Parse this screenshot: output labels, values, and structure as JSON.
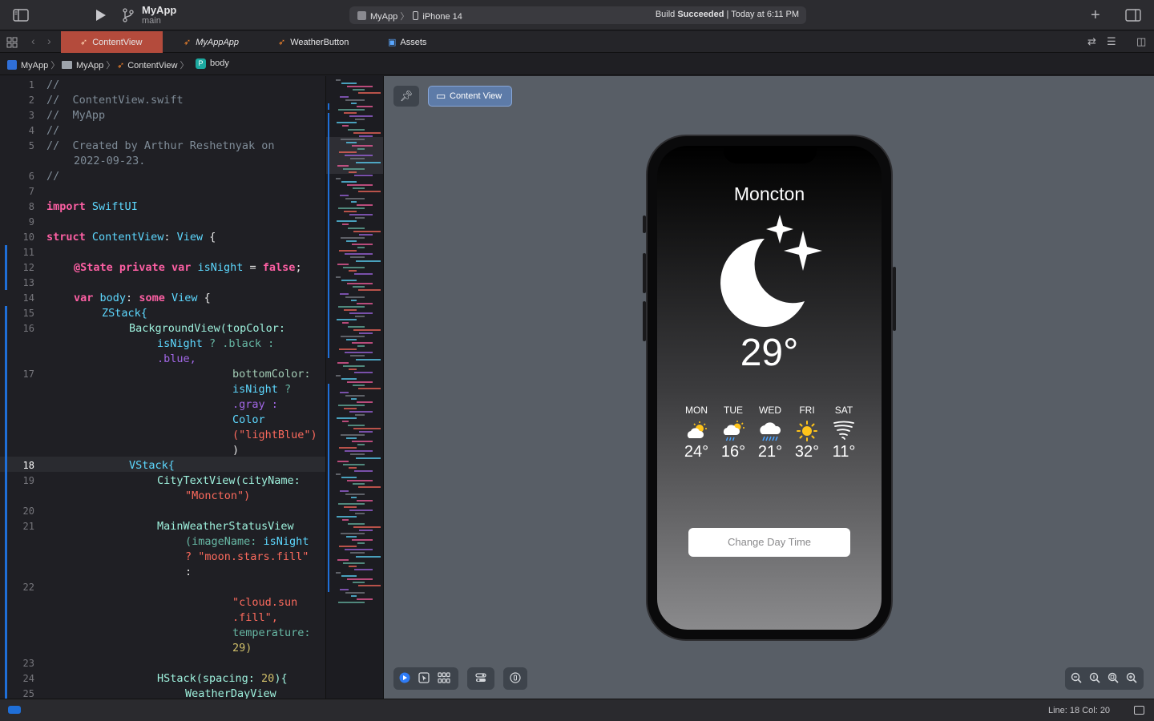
{
  "toolbar": {
    "project_name": "MyApp",
    "branch": "main",
    "scheme": "MyApp",
    "scheme_sep": "〉",
    "device": "iPhone 14",
    "build_label": "Build ",
    "build_status": "Succeeded",
    "build_time": " | Today at 6:11 PM"
  },
  "tabs": [
    {
      "label": "ContentView",
      "active": true
    },
    {
      "label": "MyAppApp",
      "active": false
    },
    {
      "label": "WeatherButton",
      "active": false
    },
    {
      "label": "Assets",
      "active": false
    }
  ],
  "jumpbar": {
    "items": [
      "MyApp",
      "MyApp",
      "ContentView",
      "body"
    ],
    "sep": "〉",
    "body_badge": "P"
  },
  "editor": {
    "current_line": "18",
    "lines": [
      {
        "num": "1",
        "text": "//"
      },
      {
        "num": "2",
        "text": "//  ContentView.swift"
      },
      {
        "num": "3",
        "text": "//  MyApp"
      },
      {
        "num": "4",
        "text": "//"
      },
      {
        "num": "5",
        "text": "//  Created by Arthur Reshetnyak on"
      },
      {
        "num": "",
        "text": "2022-09-23."
      },
      {
        "num": "6",
        "text": "//"
      },
      {
        "num": "7",
        "text": ""
      },
      {
        "num": "8",
        "text": "import SwiftUI"
      },
      {
        "num": "9",
        "text": ""
      },
      {
        "num": "10",
        "text": "struct ContentView: View {"
      },
      {
        "num": "11",
        "text": ""
      },
      {
        "num": "12",
        "text": "@State private var isNight = false;"
      },
      {
        "num": "13",
        "text": ""
      },
      {
        "num": "14",
        "text": "var body: some View {"
      },
      {
        "num": "15",
        "text": "ZStack{"
      },
      {
        "num": "16",
        "text": "BackgroundView(topColor:"
      },
      {
        "num": "",
        "text": "isNight ? .black :"
      },
      {
        "num": "",
        "text": ".blue,"
      },
      {
        "num": "17",
        "text": "bottomColor:"
      },
      {
        "num": "",
        "text": "isNight ?"
      },
      {
        "num": "",
        "text": ".gray :"
      },
      {
        "num": "",
        "text": "Color"
      },
      {
        "num": "",
        "text": "(\"lightBlue\")"
      },
      {
        "num": "",
        "text": ")"
      },
      {
        "num": "18",
        "text": "VStack{"
      },
      {
        "num": "19",
        "text": "CityTextView(cityName:"
      },
      {
        "num": "",
        "text": "\"Moncton\")"
      },
      {
        "num": "20",
        "text": ""
      },
      {
        "num": "21",
        "text": "MainWeatherStatusView"
      },
      {
        "num": "",
        "text": "(imageName: isNight"
      },
      {
        "num": "",
        "text": "? \"moon.stars.fill\""
      },
      {
        "num": "",
        "text": ":"
      },
      {
        "num": "22",
        "text": ""
      },
      {
        "num": "",
        "text": "\"cloud.sun"
      },
      {
        "num": "",
        "text": ".fill\","
      },
      {
        "num": "",
        "text": "temperature:"
      },
      {
        "num": "",
        "text": "29)"
      },
      {
        "num": "23",
        "text": ""
      },
      {
        "num": "24",
        "text": "HStack(spacing: 20){"
      },
      {
        "num": "25",
        "text": "WeatherDayView"
      }
    ]
  },
  "canvas": {
    "preview_label": "Content View"
  },
  "preview": {
    "city": "Moncton",
    "temperature": "29°",
    "main_icon": "moon-stars-fill-icon",
    "days": [
      {
        "day": "MON",
        "icon": "cloud-sun-fill-icon",
        "temp": "24°"
      },
      {
        "day": "TUE",
        "icon": "cloud-sun-rain-fill-icon",
        "temp": "16°"
      },
      {
        "day": "WED",
        "icon": "cloud-rain-fill-icon",
        "temp": "21°"
      },
      {
        "day": "FRI",
        "icon": "sun-max-fill-icon",
        "temp": "32°"
      },
      {
        "day": "SAT",
        "icon": "tornado-icon",
        "temp": "11°"
      }
    ],
    "button_label": "Change Day Time"
  },
  "statusbar": {
    "line_col": "Line: 18  Col: 20"
  },
  "colors": {
    "active_tab": "#b44b3c",
    "accent": "#1f6fd8",
    "keyword": "#fc5fa3",
    "type": "#5dd8ff",
    "string": "#fc6a5d",
    "number": "#d0bf69",
    "sun": "#ffc41a",
    "rain": "#4aa3ff"
  }
}
